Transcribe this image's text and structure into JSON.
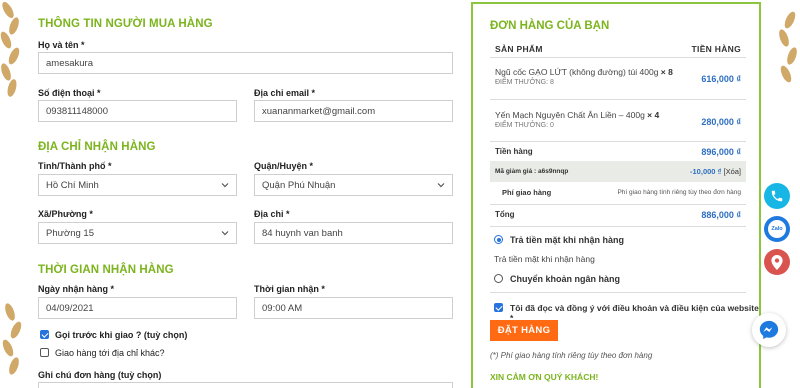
{
  "buyer": {
    "section_title": "THÔNG TIN NGƯỜI MUA HÀNG",
    "fullname_label": "Họ và tên *",
    "fullname_value": "amesakura",
    "phone_label": "Số điện thoại *",
    "phone_value": "093811148000",
    "email_label": "Địa chỉ email *",
    "email_value": "xuananmarket@gmail.com"
  },
  "address": {
    "section_title": "ĐỊA CHỈ NHẬN HÀNG",
    "city_label": "Tỉnh/Thành phố *",
    "city_value": "Hồ Chí Minh",
    "district_label": "Quận/Huyện *",
    "district_value": "Quận Phú Nhuận",
    "ward_label": "Xã/Phường *",
    "ward_value": "Phường 15",
    "street_label": "Địa chỉ *",
    "street_value": "84 huynh van banh"
  },
  "delivery_time": {
    "section_title": "THỜI GIAN NHẬN HÀNG",
    "date_label": "Ngày nhận hàng *",
    "date_value": "04/09/2021",
    "time_label": "Thời gian nhận *",
    "time_value": "09:00 AM",
    "call_before_label": "Gọi trước khi giao ? (tuỳ chọn)",
    "call_before_checked": true,
    "other_address_label": "Giao hàng tới địa chỉ khác?",
    "other_address_checked": false,
    "note_label": "Ghi chú đơn hàng (tuỳ chọn)"
  },
  "order": {
    "title": "ĐƠN HÀNG CỦA BẠN",
    "col_product": "SẢN PHẨM",
    "col_total": "TIỀN HÀNG",
    "items": [
      {
        "name": "Ngũ cốc GẠO LỨT (không đường) túi 400g",
        "qty": "× 8",
        "points": "ĐIỂM THƯỞNG:  8",
        "price": "616,000 ₫"
      },
      {
        "name": "Yến Mạch Nguyên Chất Ăn Liền – 400g",
        "qty": "× 4",
        "points": "ĐIỂM THƯỞNG:  0",
        "price": "280,000 ₫"
      }
    ],
    "subtotal_label": "Tiền hàng",
    "subtotal_value": "896,000 ₫",
    "coupon_label": "Mã giảm giá : a6s9nnqp",
    "coupon_value": "-10,000 ₫",
    "coupon_remove": "[Xóa]",
    "shipping_label": "Phí giao hàng",
    "shipping_value": "Phí giao hàng tính riêng tùy theo đơn hàng",
    "total_label": "Tổng",
    "total_value": "886,000 ₫",
    "payment_cod_label": "Trả tiền mặt khi nhận hàng",
    "payment_cod_desc": "Trả tiền mặt khi nhận hàng",
    "payment_bank_label": "Chuyển khoản ngân hàng",
    "selected_payment": "cod",
    "terms_label": "Tôi đã đọc và đồng ý với điều khoản và điều kiện của website *",
    "terms_checked": true,
    "place_order": "ĐẶT HÀNG",
    "footnote": "(*) Phí giao hàng tính riêng tùy theo đơn hàng",
    "thanks": "XIN CẢM ƠN QUÝ KHÁCH!"
  },
  "floating": {
    "zalo_text": "Zalo"
  },
  "colors": {
    "accent_green": "#7cb41e",
    "border_green": "#8cc63f",
    "price_blue": "#2e6fc0",
    "button_orange": "#ff6a13",
    "check_blue": "#2673dd"
  }
}
